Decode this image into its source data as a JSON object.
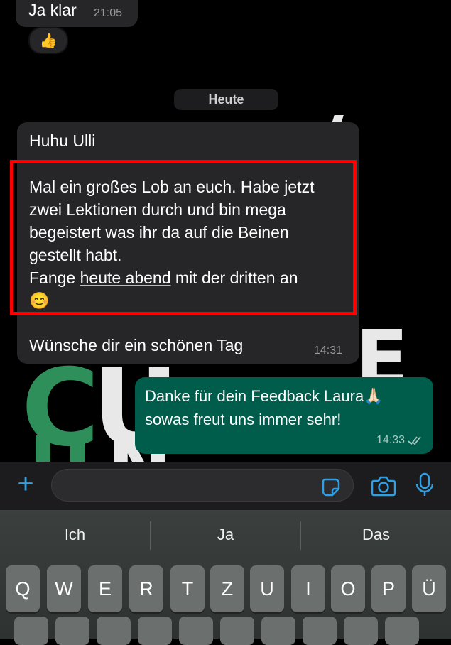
{
  "chat": {
    "prev_message": {
      "text": "Ja klar",
      "time": "21:05"
    },
    "reaction_emoji": "👍",
    "day_separator": "Heute",
    "incoming": {
      "greeting": "Huhu Ulli",
      "body_lines": [
        "Mal ein großes Lob an euch. Habe jetzt",
        "zwei Lektionen durch und bin mega",
        "begeistert was ihr da auf die Beinen",
        "gestellt habt."
      ],
      "line5_pre": "Fange ",
      "line5_link": "heute abend",
      "line5_post": " mit der dritten an",
      "emoji": "😊",
      "closing": "Wünsche dir ein schönen Tag",
      "time": "14:31"
    },
    "outgoing": {
      "line1": "Danke für dein Feedback Laura🙏🏻",
      "line2": "sowas freut uns immer sehr!",
      "time": "14:33"
    }
  },
  "input_bar": {
    "plus_label": "+",
    "icons": [
      "plus-icon",
      "sticker-icon",
      "camera-icon",
      "mic-icon"
    ]
  },
  "keyboard": {
    "suggestions": [
      "Ich",
      "Ja",
      "Das"
    ],
    "row1": [
      "Q",
      "W",
      "E",
      "R",
      "T",
      "Z",
      "U",
      "I",
      "O",
      "P",
      "Ü"
    ]
  },
  "colors": {
    "incoming_bubble": "#262628",
    "outgoing_bubble": "#005c4b",
    "highlight": "#ff0000",
    "accent": "#2ea0e6"
  }
}
